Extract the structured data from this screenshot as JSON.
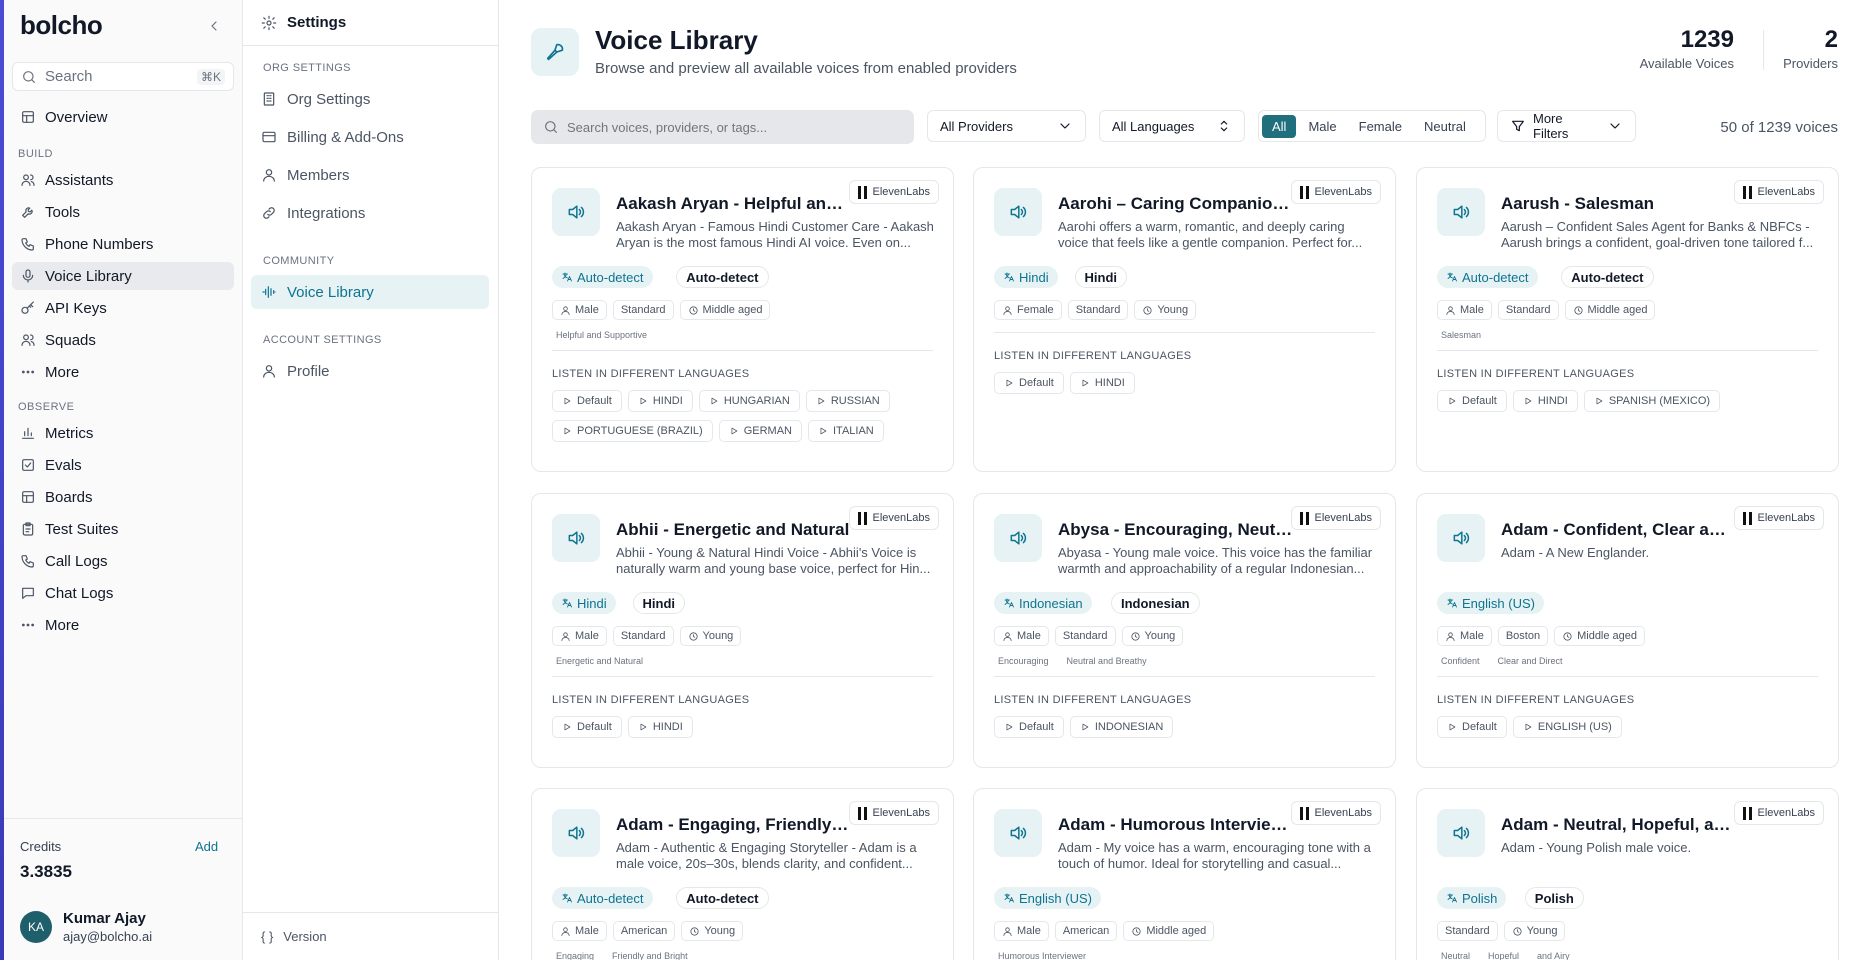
{
  "app": {
    "brand": "bolcho",
    "search_placeholder": "Search",
    "search_shortcut": "⌘K"
  },
  "sidebar": {
    "overview": "Overview",
    "build_label": "BUILD",
    "build": [
      "Assistants",
      "Tools",
      "Phone Numbers",
      "Voice Library",
      "API Keys",
      "Squads",
      "More"
    ],
    "observe_label": "OBSERVE",
    "observe": [
      "Metrics",
      "Evals",
      "Boards",
      "Test Suites",
      "Call Logs",
      "Chat Logs",
      "More"
    ],
    "credits_label": "Credits",
    "credits_add": "Add",
    "credits_value": "3.3835",
    "user": {
      "initials": "KA",
      "name": "Kumar Ajay",
      "email": "ajay@bolcho.ai"
    }
  },
  "settings": {
    "title": "Settings",
    "org_label": "ORG SETTINGS",
    "org_items": [
      "Org Settings",
      "Billing & Add-Ons",
      "Members",
      "Integrations"
    ],
    "community_label": "COMMUNITY",
    "community_items": [
      "Voice Library"
    ],
    "account_label": "ACCOUNT SETTINGS",
    "account_items": [
      "Profile"
    ],
    "version": "Version"
  },
  "main": {
    "title": "Voice Library",
    "subtitle": "Browse and preview all available voices from enabled providers",
    "stats": [
      {
        "value": "1239",
        "label": "Available Voices"
      },
      {
        "value": "2",
        "label": "Providers"
      }
    ],
    "search_placeholder": "Search voices, providers, or tags...",
    "provider_select": "All Providers",
    "language_select": "All Languages",
    "gender_tabs": [
      "All",
      "Male",
      "Female",
      "Neutral"
    ],
    "gender_selected": "All",
    "more_filters": "More Filters",
    "result_count": "50 of 1239 voices",
    "listen_label": "LISTEN IN DIFFERENT LANGUAGES"
  },
  "colors": {
    "accent": "#0e7490",
    "accent_soft": "#e6f2f4",
    "segment_active": "#1f6f7d",
    "brand_bar": "#4b4bd6"
  },
  "cards": [
    {
      "name": "Aakash Aryan - Helpful and Supportive",
      "provider": "ElevenLabs",
      "description": "Aakash Aryan - Famous Hindi Customer Care - Aakash Aryan is the most famous Hindi AI voice. Even on...",
      "language": "Auto-detect",
      "accent": "Auto-detect",
      "tags": [
        "Male",
        "Standard",
        "Middle aged"
      ],
      "styles": [
        "Helpful and Supportive"
      ],
      "languages": [
        "Default",
        "HINDI",
        "HUNGARIAN",
        "RUSSIAN",
        "PORTUGUESE (BRAZIL)",
        "GERMAN",
        "ITALIAN"
      ]
    },
    {
      "name": "Aarohi – Caring Companion Voice",
      "provider": "ElevenLabs",
      "description": "Aarohi offers a warm, romantic, and deeply caring voice that feels like a gentle companion. Perfect for...",
      "language": "Hindi",
      "accent": "Hindi",
      "tags": [
        "Female",
        "Standard",
        "Young"
      ],
      "styles": [],
      "languages": [
        "Default",
        "HINDI"
      ]
    },
    {
      "name": "Aarush - Salesman",
      "provider": "ElevenLabs",
      "description": "Aarush – Confident Sales Agent for Banks & NBFCs - Aarush brings a confident, goal-driven tone tailored f...",
      "language": "Auto-detect",
      "accent": "Auto-detect",
      "tags": [
        "Male",
        "Standard",
        "Middle aged"
      ],
      "styles": [
        "Salesman"
      ],
      "languages": [
        "Default",
        "HINDI",
        "SPANISH (MEXICO)"
      ]
    },
    {
      "name": "Abhii - Energetic and Natural",
      "provider": "ElevenLabs",
      "description": "Abhii - Young & Natural Hindi Voice - Abhii's Voice is naturally warm and young base voice, perfect for Hin...",
      "language": "Hindi",
      "accent": "Hindi",
      "tags": [
        "Male",
        "Standard",
        "Young"
      ],
      "styles": [
        "Energetic and Natural"
      ],
      "languages": [
        "Default",
        "HINDI"
      ]
    },
    {
      "name": "Abysa - Encouraging, Neutral and Breathy",
      "provider": "ElevenLabs",
      "description": "Abyasa - Young male voice. This voice has the familiar warmth and approachability of a regular Indonesian...",
      "language": "Indonesian",
      "accent": "Indonesian",
      "tags": [
        "Male",
        "Standard",
        "Young"
      ],
      "styles": [
        "Encouraging",
        "Neutral and Breathy"
      ],
      "languages": [
        "Default",
        "INDONESIAN"
      ]
    },
    {
      "name": "Adam - Confident, Clear and Direct",
      "provider": "ElevenLabs",
      "description": "Adam - A New Englander.",
      "language": "English (US)",
      "accent": "",
      "tags": [
        "Male",
        "Boston",
        "Middle aged"
      ],
      "styles": [
        "Confident",
        "Clear and Direct"
      ],
      "languages": [
        "Default",
        "ENGLISH (US)"
      ]
    },
    {
      "name": "Adam - Engaging, Friendly and Bright",
      "provider": "ElevenLabs",
      "description": "Adam - Authentic & Engaging Storyteller - Adam is a male voice, 20s–30s, blends clarity, and confident...",
      "language": "Auto-detect",
      "accent": "Auto-detect",
      "tags": [
        "Male",
        "American",
        "Young"
      ],
      "styles": [
        "Engaging",
        "Friendly and Bright"
      ],
      "languages": []
    },
    {
      "name": "Adam - Humorous Interviewer",
      "provider": "ElevenLabs",
      "description": "Adam - My voice has a warm, encouraging tone with a touch of humor. Ideal for storytelling and casual...",
      "language": "English (US)",
      "accent": "",
      "tags": [
        "Male",
        "American",
        "Middle aged"
      ],
      "styles": [
        "Humorous Interviewer"
      ],
      "languages": []
    },
    {
      "name": "Adam - Neutral, Hopeful, and Airy",
      "provider": "ElevenLabs",
      "description": "Adam - Young Polish male voice.",
      "language": "Polish",
      "accent": "Polish",
      "tags": [
        "Standard",
        "Young"
      ],
      "styles": [
        "Neutral",
        "Hopeful",
        "and Airy"
      ],
      "languages": []
    }
  ]
}
